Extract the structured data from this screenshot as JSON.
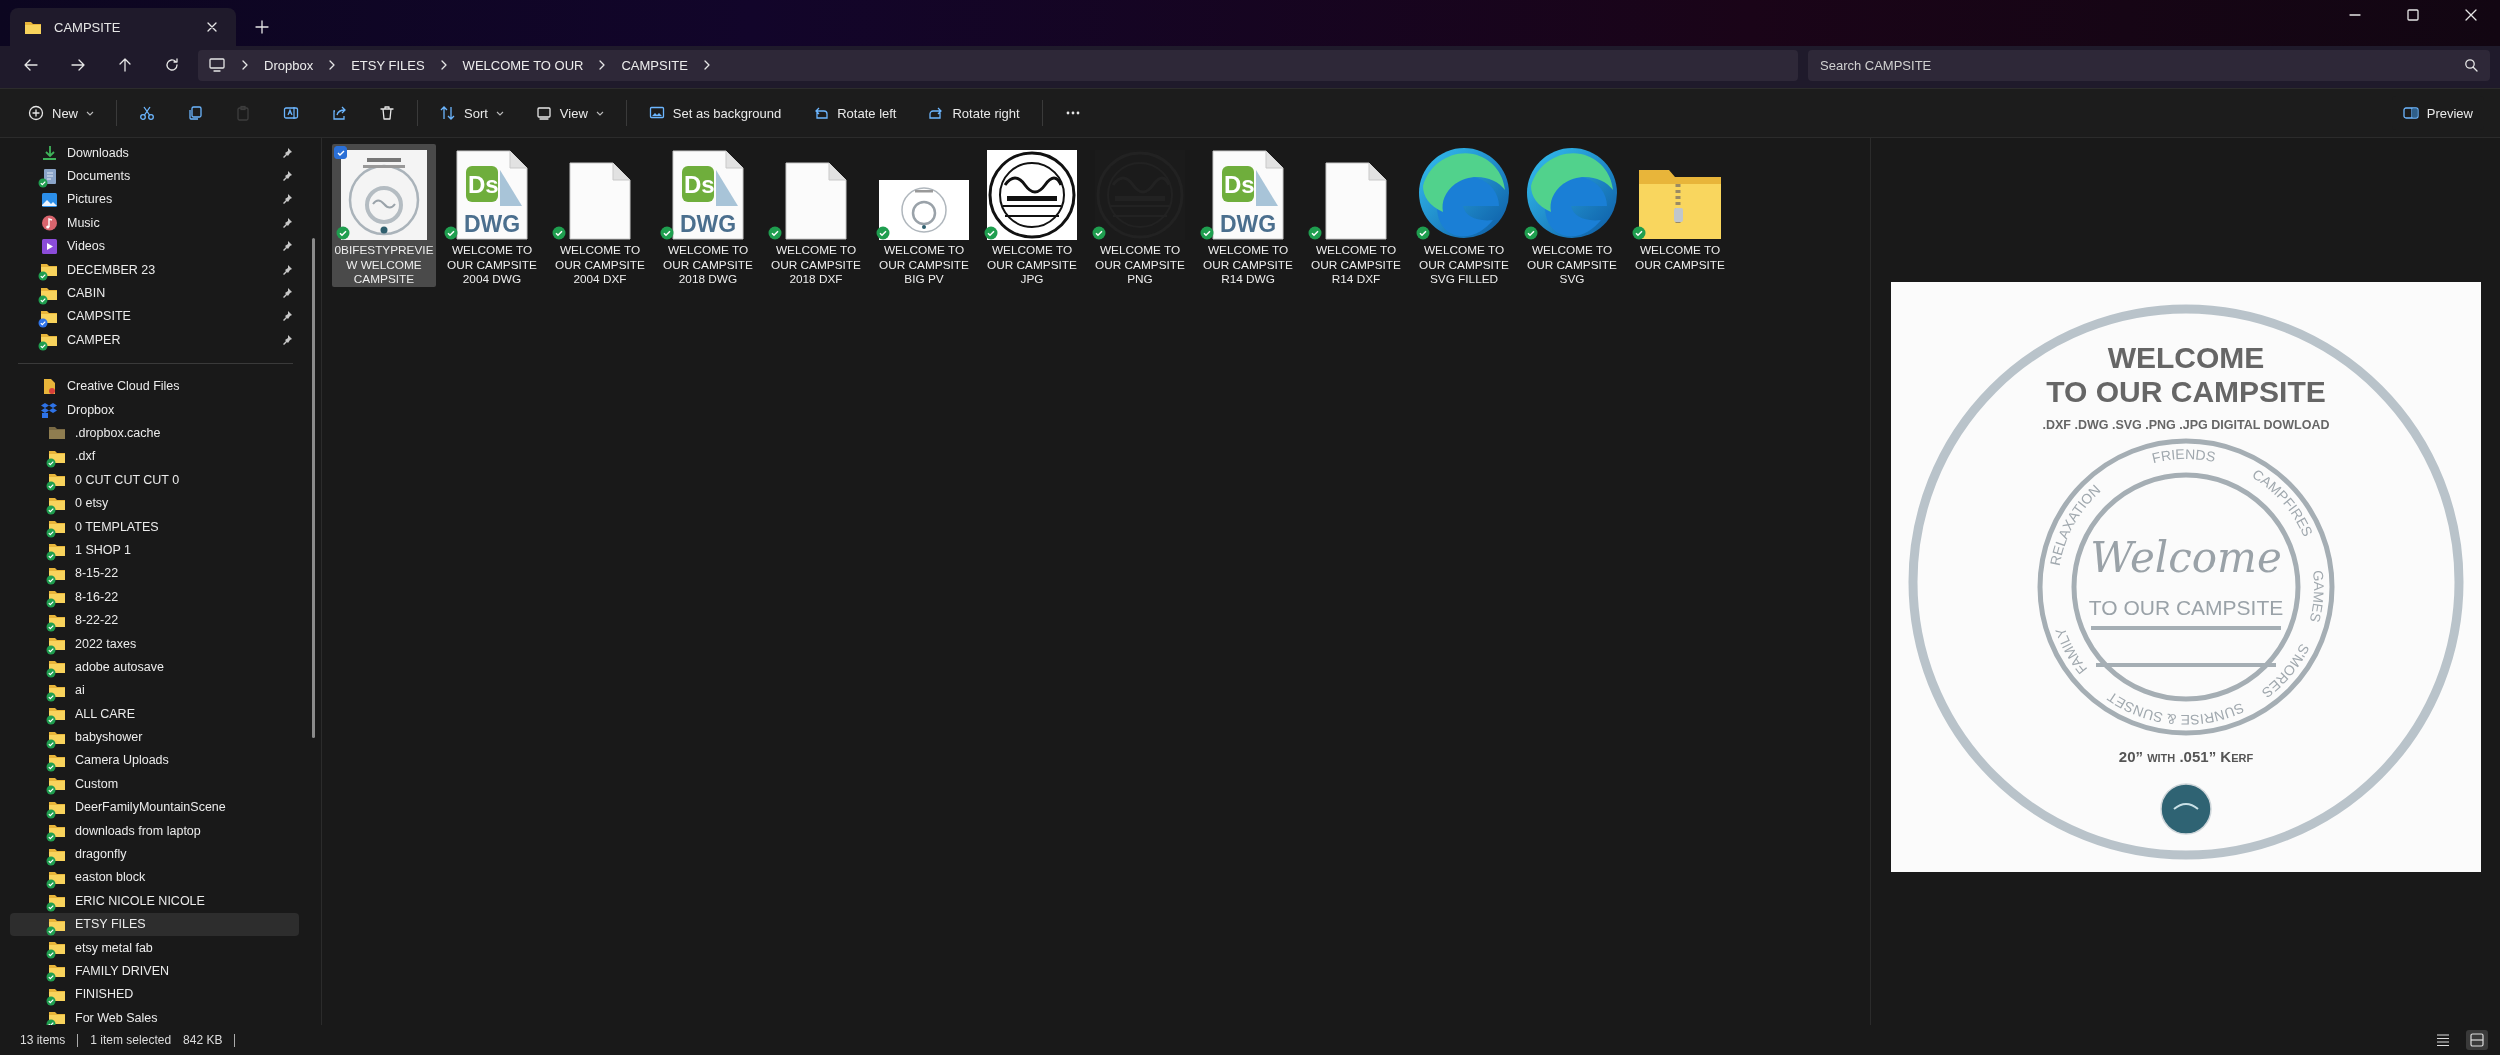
{
  "window": {
    "tab_title": "CAMPSITE"
  },
  "address": {
    "path": [
      "Dropbox",
      "ETSY FILES",
      "WELCOME TO OUR",
      "CAMPSITE"
    ]
  },
  "search": {
    "placeholder": "Search CAMPSITE"
  },
  "toolbar": [
    {
      "kind": "new",
      "label": "New",
      "disabled": false
    },
    {
      "kind": "cut",
      "disabled": false
    },
    {
      "kind": "copy",
      "disabled": false
    },
    {
      "kind": "paste",
      "disabled": true
    },
    {
      "kind": "rename",
      "disabled": false
    },
    {
      "kind": "share",
      "disabled": false
    },
    {
      "kind": "delete",
      "disabled": false
    },
    {
      "kind": "sort",
      "label": "Sort",
      "disabled": false
    },
    {
      "kind": "view",
      "label": "View",
      "disabled": false
    },
    {
      "kind": "background",
      "label": "Set as background",
      "disabled": false
    },
    {
      "kind": "rotate-left",
      "label": "Rotate left",
      "disabled": false
    },
    {
      "kind": "rotate-right",
      "label": "Rotate right",
      "disabled": false
    },
    {
      "kind": "more",
      "disabled": false
    }
  ],
  "preview_toggle": {
    "label": "Preview",
    "on": true
  },
  "sidebar": {
    "pinned": [
      {
        "label": "Downloads",
        "kind": "downloads",
        "selected": false
      },
      {
        "label": "Documents",
        "kind": "documents",
        "color": "#1f9e4f",
        "selected": false
      },
      {
        "label": "Pictures",
        "kind": "pictures",
        "selected": false
      },
      {
        "label": "Music",
        "kind": "music",
        "selected": false
      },
      {
        "label": "Videos",
        "kind": "videos",
        "selected": false
      },
      {
        "label": "DECEMBER 23",
        "kind": "folder",
        "color": "#1f9e4f",
        "selected": false
      },
      {
        "label": "CABIN",
        "kind": "folder",
        "color": "#1f9e4f",
        "selected": false
      },
      {
        "label": "CAMPSITE",
        "kind": "folder",
        "color": "#2e73e8",
        "selected": false
      },
      {
        "label": "CAMPER",
        "kind": "folder",
        "color": "#1f9e4f",
        "selected": false
      }
    ],
    "locations": [
      {
        "label": "Creative Cloud Files",
        "kind": "cloud",
        "selected": false
      },
      {
        "label": "Dropbox",
        "kind": "dropbox",
        "selected": false,
        "children": [
          {
            "label": ".dropbox.cache",
            "kind": "hidden-folder",
            "selected": false
          },
          {
            "label": ".dxf",
            "kind": "folder",
            "color": "#1f9e4f",
            "selected": false
          },
          {
            "label": "0 CUT CUT CUT 0",
            "kind": "folder",
            "color": "#1f9e4f",
            "selected": false
          },
          {
            "label": "0 etsy",
            "kind": "folder",
            "color": "#1f9e4f",
            "selected": false
          },
          {
            "label": "0 TEMPLATES",
            "kind": "folder",
            "color": "#1f9e4f",
            "selected": false
          },
          {
            "label": "1 SHOP 1",
            "kind": "folder",
            "color": "#1f9e4f",
            "selected": false
          },
          {
            "label": "8-15-22",
            "kind": "folder",
            "color": "#1f9e4f",
            "selected": false
          },
          {
            "label": "8-16-22",
            "kind": "folder",
            "color": "#1f9e4f",
            "selected": false
          },
          {
            "label": "8-22-22",
            "kind": "folder",
            "color": "#1f9e4f",
            "selected": false
          },
          {
            "label": "2022 taxes",
            "kind": "folder",
            "color": "#1f9e4f",
            "selected": false
          },
          {
            "label": "adobe autosave",
            "kind": "folder",
            "color": "#1f9e4f",
            "selected": false
          },
          {
            "label": "ai",
            "kind": "folder",
            "color": "#1f9e4f",
            "selected": false
          },
          {
            "label": "ALL CARE",
            "kind": "folder",
            "color": "#1f9e4f",
            "selected": false
          },
          {
            "label": "babyshower",
            "kind": "folder",
            "color": "#1f9e4f",
            "selected": false
          },
          {
            "label": "Camera Uploads",
            "kind": "folder",
            "color": "#1f9e4f",
            "selected": false
          },
          {
            "label": "Custom",
            "kind": "folder",
            "color": "#1f9e4f",
            "selected": false
          },
          {
            "label": "DeerFamilyMountainScene",
            "kind": "folder",
            "color": "#1f9e4f",
            "selected": false
          },
          {
            "label": "downloads from laptop",
            "kind": "folder",
            "color": "#1f9e4f",
            "selected": false
          },
          {
            "label": "dragonfly",
            "kind": "folder",
            "color": "#1f9e4f",
            "selected": false
          },
          {
            "label": "easton block",
            "kind": "folder",
            "color": "#1f9e4f",
            "selected": false
          },
          {
            "label": "ERIC NICOLE NICOLE",
            "kind": "folder",
            "color": "#1f9e4f",
            "selected": false
          },
          {
            "label": "ETSY FILES",
            "kind": "folder",
            "color": "#1f9e4f",
            "selected": true
          },
          {
            "label": "etsy metal fab",
            "kind": "folder",
            "color": "#1f9e4f",
            "selected": false
          },
          {
            "label": "FAMILY DRIVEN",
            "kind": "folder",
            "color": "#1f9e4f",
            "selected": false
          },
          {
            "label": "FINISHED",
            "kind": "folder",
            "color": "#1f9e4f",
            "selected": false
          },
          {
            "label": "For Web Sales",
            "kind": "folder",
            "color": "#1f9e4f",
            "selected": false
          }
        ]
      }
    ]
  },
  "files": [
    {
      "name": "0BIFESTYPREVIEW WELCOME CAMPSITE",
      "kind": "sheet",
      "selected": true,
      "checked": true
    },
    {
      "name": "WELCOME TO OUR CAMPSITE 2004 DWG",
      "kind": "dwg",
      "icon_letters": "Ds",
      "icon_caption": "DWG",
      "selected": false,
      "checked": false
    },
    {
      "name": "WELCOME TO OUR CAMPSITE 2004 DXF",
      "kind": "blank",
      "selected": false,
      "checked": false
    },
    {
      "name": "WELCOME TO OUR CAMPSITE 2018 DWG",
      "kind": "dwg",
      "icon_letters": "Ds",
      "icon_caption": "DWG",
      "selected": false,
      "checked": false
    },
    {
      "name": "WELCOME TO OUR CAMPSITE 2018 DXF",
      "kind": "blank",
      "selected": false,
      "checked": false
    },
    {
      "name": "WELCOME TO OUR CAMPSITE BIG PV",
      "kind": "wide",
      "selected": false,
      "checked": false
    },
    {
      "name": "WELCOME TO OUR CAMPSITE JPG",
      "kind": "ring-light",
      "selected": false,
      "checked": false
    },
    {
      "name": "WELCOME TO OUR CAMPSITE PNG",
      "kind": "ring-dark",
      "selected": false,
      "checked": false
    },
    {
      "name": "WELCOME TO OUR CAMPSITE R14 DWG",
      "kind": "dwg",
      "icon_letters": "Ds",
      "icon_caption": "DWG",
      "selected": false,
      "checked": false
    },
    {
      "name": "WELCOME TO OUR CAMPSITE R14 DXF",
      "kind": "blank",
      "selected": false,
      "checked": false
    },
    {
      "name": "WELCOME TO OUR CAMPSITE SVG FILLED",
      "kind": "browser",
      "selected": false,
      "checked": false
    },
    {
      "name": "WELCOME TO OUR CAMPSITE SVG",
      "kind": "browser",
      "selected": false,
      "checked": false
    },
    {
      "name": "WELCOME TO OUR CAMPSITE",
      "kind": "zip",
      "selected": false,
      "checked": false
    }
  ],
  "preview": {
    "heading_1": "WELCOME",
    "heading_2": "TO OUR CAMPSITE",
    "formats": ".DXF .DWG .SVG .PNG .JPG DIGITAL DOWLOAD",
    "script_word": "Welcome",
    "sub_line": "TO OUR CAMPSITE",
    "ring_words": [
      "FRIENDS",
      "RELAXATION",
      "CAMPFIRES",
      "GAMES",
      "FAMILY",
      "S'MORES",
      "SUNRISE & SUNSET"
    ],
    "size_note": "20” with .051” Kerf"
  },
  "status_bar": {
    "item_count": "13 items",
    "selection": "1 item selected",
    "size": "842 KB",
    "view_modes": [
      {
        "kind": "details",
        "selected": false
      },
      {
        "kind": "tiles",
        "selected": true
      }
    ]
  }
}
